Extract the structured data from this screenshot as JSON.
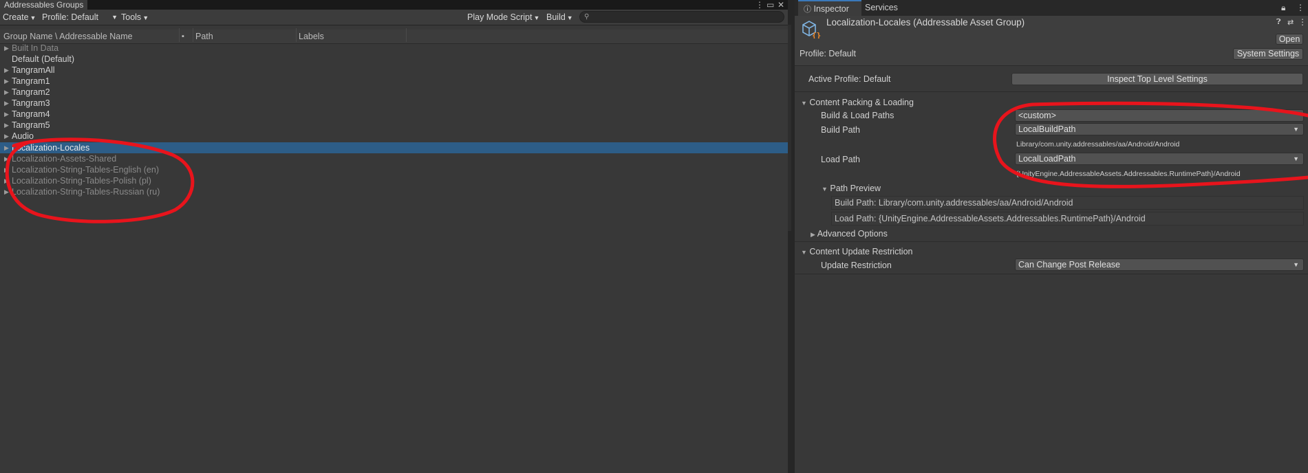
{
  "left_panel": {
    "tab_title": "Addressables Groups",
    "toolbar": {
      "create_label": "Create",
      "profile_label": "Profile: Default",
      "tools_label": "Tools",
      "play_mode_label": "Play Mode Script",
      "build_label": "Build"
    },
    "columns": {
      "name": "Group Name \\ Addressable Name",
      "path": "Path",
      "labels": "Labels"
    },
    "rows": [
      {
        "label": "Built In Data"
      },
      {
        "label": "Default (Default)"
      },
      {
        "label": "TangramAll"
      },
      {
        "label": "Tangram1"
      },
      {
        "label": "Tangram2"
      },
      {
        "label": "Tangram3"
      },
      {
        "label": "Tangram4"
      },
      {
        "label": "Tangram5"
      },
      {
        "label": "Audio"
      },
      {
        "label": "Localization-Locales"
      },
      {
        "label": "Localization-Assets-Shared"
      },
      {
        "label": "Localization-String-Tables-English (en)"
      },
      {
        "label": "Localization-String-Tables-Polish (pl)"
      },
      {
        "label": "Localization-String-Tables-Russian (ru)"
      }
    ]
  },
  "right_panel": {
    "tabs": {
      "inspector": "Inspector",
      "services": "Services"
    },
    "header": {
      "title": "Localization-Locales (Addressable Asset Group)",
      "open_label": "Open",
      "profile_label": "Profile: Default",
      "system_settings_label": "System Settings"
    },
    "active_profile_label": "Active Profile: Default",
    "inspect_top_level_label": "Inspect Top Level Settings",
    "content_packing": {
      "section_label": "Content Packing & Loading",
      "build_load_paths_label": "Build & Load Paths",
      "build_load_paths_value": "<custom>",
      "build_path_label": "Build Path",
      "build_path_value": "LocalBuildPath",
      "build_path_resolved": "Library/com.unity.addressables/aa/Android/Android",
      "load_path_label": "Load Path",
      "load_path_value": "LocalLoadPath",
      "load_path_resolved": "{UnityEngine.AddressableAssets.Addressables.RuntimePath}/Android",
      "path_preview_label": "Path Preview",
      "preview_build": "Build Path: Library/com.unity.addressables/aa/Android/Android",
      "preview_load": "Load Path: {UnityEngine.AddressableAssets.Addressables.RuntimePath}/Android",
      "advanced_label": "Advanced Options"
    },
    "content_update": {
      "section_label": "Content Update Restriction",
      "update_restriction_label": "Update Restriction",
      "update_restriction_value": "Can Change Post Release"
    }
  },
  "colors": {
    "selection": "#2d5d87",
    "annotation": "#e8141c",
    "accent": "#3a79bb"
  },
  "icons": [
    "kebab-menu-icon",
    "maximize-icon",
    "close-icon",
    "search-icon",
    "info-icon",
    "lock-icon",
    "asset-group-icon",
    "help-icon",
    "preset-icon"
  ]
}
